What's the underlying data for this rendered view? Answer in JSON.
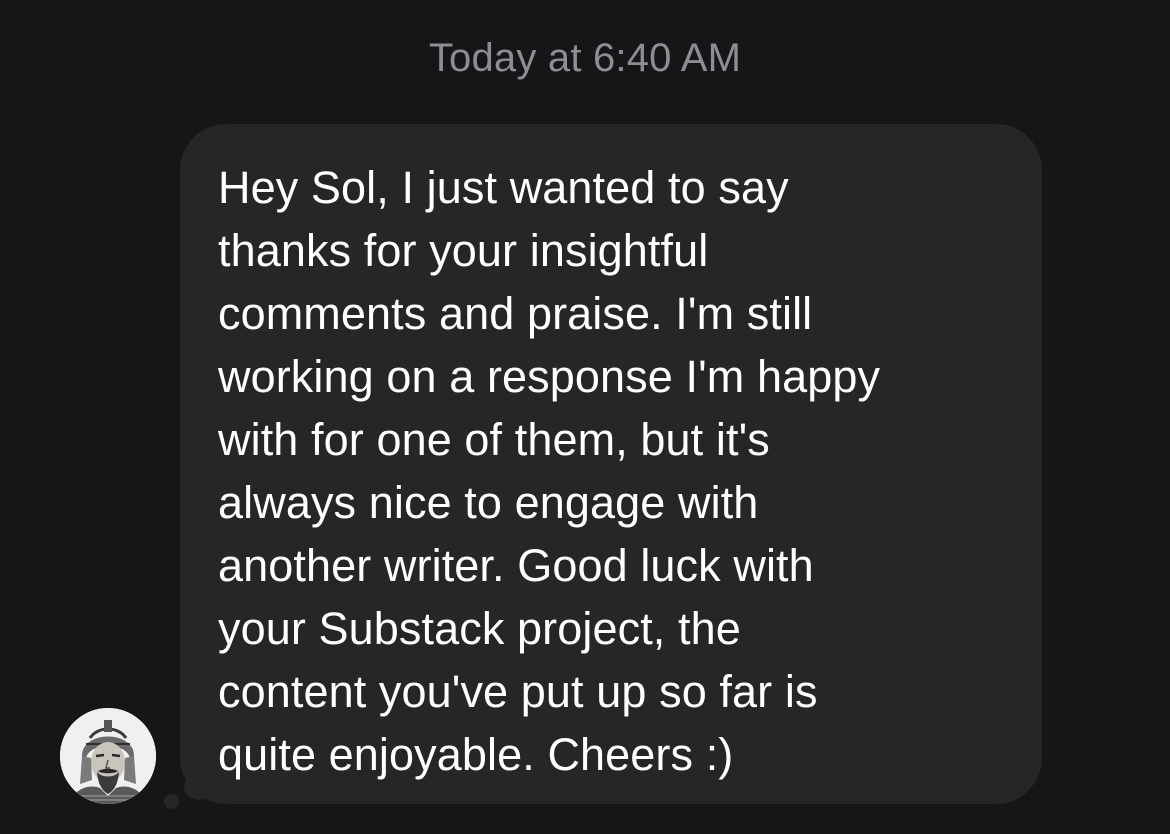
{
  "conversation": {
    "timestamp": "Today at 6:40 AM",
    "message": {
      "text": "Hey Sol, I just wanted to say\nthanks for your insightful\ncomments and praise. I'm still\nworking on a response I'm happy\nwith for one of them, but it's\nalways nice to engage with\nanother writer. Good luck with\nyour Substack project, the\ncontent you've put up so far is\nquite enjoyable. Cheers :)"
    },
    "sender_avatar": {
      "icon": "bearded-warrior-portrait-avatar"
    }
  },
  "colors": {
    "background": "#161618",
    "bubble": "#262628",
    "timestamp_text": "#8d8d92",
    "message_text": "#ffffff"
  }
}
